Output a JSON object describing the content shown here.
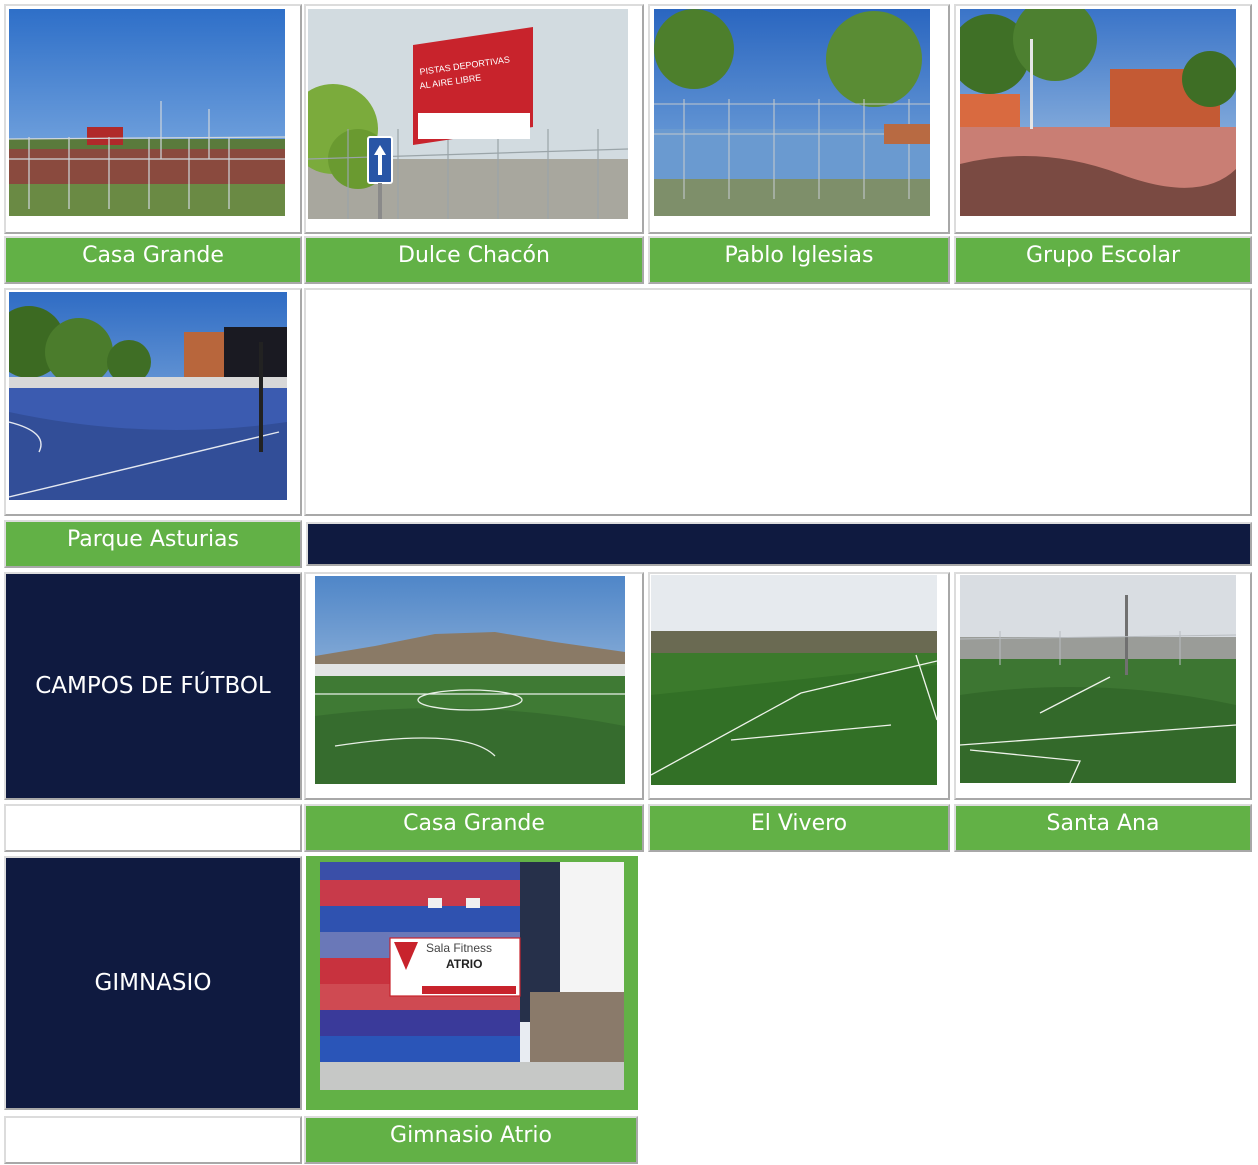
{
  "rows": {
    "row1_labels": [
      "Casa Grande",
      "Dulce Chacón",
      "Pablo Iglesias",
      "Grupo Escolar"
    ],
    "row2_label": "Parque Asturias"
  },
  "football": {
    "title": "CAMPOS DE FÚTBOL",
    "labels": [
      "Casa Grande",
      "El Vivero",
      "Santa Ana"
    ]
  },
  "gym": {
    "title": "GIMNASIO",
    "label": "Gimnasio Atrio",
    "sign": {
      "line1": "Sala Fitness",
      "line2": "ATRIO"
    }
  },
  "photo_signs": {
    "dulce_chacon": [
      "PISTAS DEPORTIVAS",
      "AL AIRE LIBRE"
    ]
  },
  "colors": {
    "green": "#62b146",
    "navy": "#0f1a40",
    "border": "#dcdcdc"
  }
}
